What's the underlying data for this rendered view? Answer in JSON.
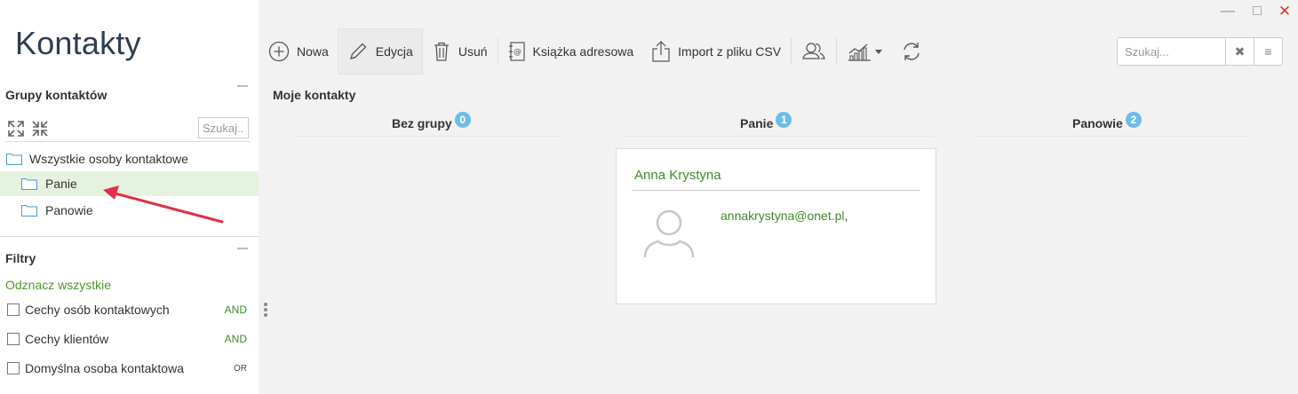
{
  "window": {
    "minimize": "—",
    "maximize": "□",
    "close": "✕"
  },
  "sidebar": {
    "app_title": "Kontakty",
    "groups": {
      "title": "Grupy kontaktów",
      "search_placeholder": "Szukaj...",
      "tree": [
        {
          "label": "Wszystkie osoby kontaktowe",
          "selected": false
        },
        {
          "label": "Panie",
          "selected": true
        },
        {
          "label": "Panowie",
          "selected": false
        }
      ]
    },
    "filters": {
      "title": "Filtry",
      "select_all": "Odznacz wszystkie",
      "items": [
        {
          "label": "Cechy osób kontaktowych",
          "operator": "AND",
          "checked": false
        },
        {
          "label": "Cechy klientów",
          "operator": "AND",
          "checked": false
        },
        {
          "label": "Domyślna osoba kontaktowa",
          "operator": "OR",
          "checked": false
        }
      ]
    }
  },
  "toolbar": {
    "new_label": "Nowa",
    "edit_label": "Edycja",
    "delete_label": "Usuń",
    "address_book_label": "Książka adresowa",
    "import_label": "Import z pliku CSV",
    "icons": [
      "plus-circle-icon",
      "pencil-icon",
      "trash-icon",
      "address-book-icon",
      "upload-icon",
      "people-icon",
      "chart-icon",
      "refresh-icon"
    ]
  },
  "search": {
    "placeholder": "Szukaj...",
    "clear": "✖",
    "menu": "≡"
  },
  "main": {
    "section_title": "Moje kontakty",
    "columns": [
      {
        "label": "Bez grupy",
        "count": "0"
      },
      {
        "label": "Panie",
        "count": "1"
      },
      {
        "label": "Panowie",
        "count": "2"
      }
    ],
    "card": {
      "name": "Anna Krystyna",
      "email": "annakrystyna@onet.pl",
      "email_suffix": ","
    }
  },
  "colors": {
    "accent_green": "#3d8c27",
    "badge_blue": "#6cbde8",
    "selected_row": "#e6f2e0",
    "annotation_red": "#e0304a",
    "title_color": "#2f3d4f"
  }
}
